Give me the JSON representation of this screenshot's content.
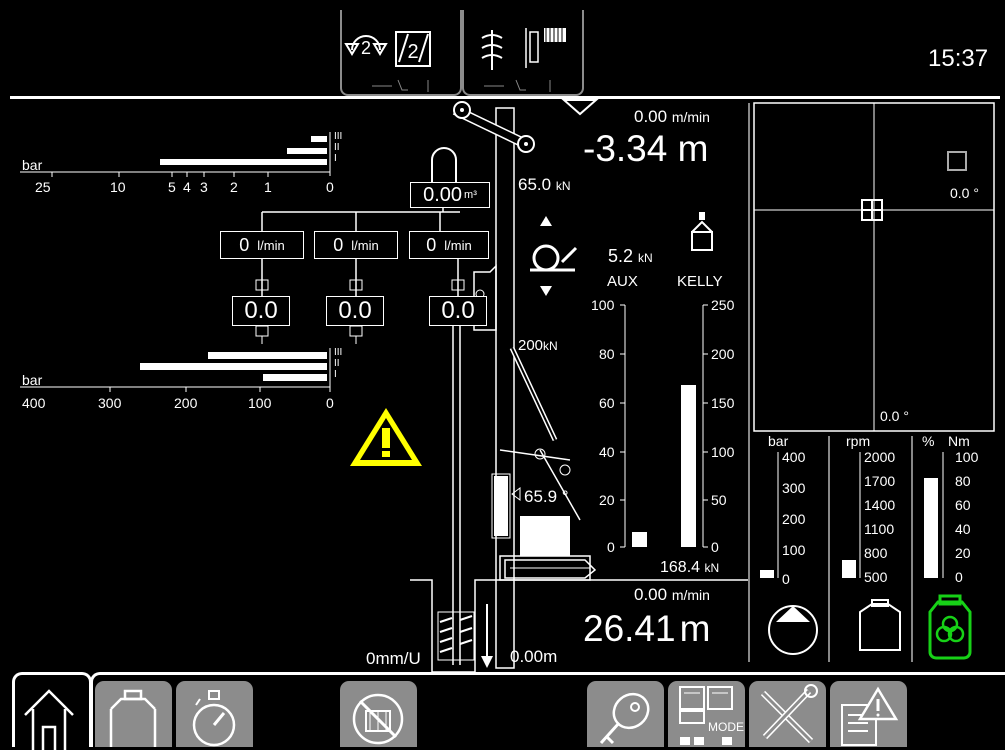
{
  "header": {
    "clock": "15:37",
    "mode_icons": [
      "rotation-2-icon",
      "winch-2-icon",
      "auger-icon",
      "winch-icon"
    ]
  },
  "pump_pressure": {
    "unit": "bar",
    "scale": [
      "25",
      "10",
      "5",
      "4",
      "3",
      "2",
      "1",
      "0"
    ],
    "level_labels": [
      "III",
      "II",
      "I"
    ]
  },
  "hydraulic": {
    "volume": "0.00",
    "volume_unit": "m³",
    "flow": [
      {
        "value": "0",
        "unit": "l/min"
      },
      {
        "value": "0",
        "unit": "l/min"
      },
      {
        "value": "0",
        "unit": "l/min"
      }
    ],
    "cylinder_values": [
      "0.0",
      "0.0",
      "0.0"
    ]
  },
  "load_pressure": {
    "unit": "bar",
    "scale": [
      "400",
      "300",
      "200",
      "100",
      "0"
    ],
    "level_labels": [
      "III",
      "II",
      "I"
    ]
  },
  "rig": {
    "crowd_force": "65.0",
    "crowd_force_unit": "kN",
    "aux_force": "5.2",
    "aux_force_unit": "kN",
    "crowd_limit": "200",
    "crowd_limit_unit": "kN",
    "mast_angle": "65.9 °",
    "aux_label": "AUX",
    "kelly_label": "KELLY",
    "rotation_ratio": "0mm/U",
    "tool_depth": "0.00m"
  },
  "kelly": {
    "speed_top": "0.00",
    "speed_top_unit": "m/min",
    "depth_top": "-3.34 m",
    "force_bottom": "168.4",
    "force_bottom_unit": "kN",
    "speed_bottom": "0.00",
    "speed_bottom_unit": "m/min",
    "depth_bottom": "26.41",
    "depth_bottom_unit": "m"
  },
  "winch_gauges": {
    "aux_scale": [
      "100",
      "80",
      "60",
      "40",
      "20",
      "0"
    ],
    "kelly_scale": [
      "250",
      "200",
      "150",
      "100",
      "50",
      "0"
    ],
    "aux_fraction": 0.06,
    "kelly_fraction": 0.67
  },
  "inclination": {
    "angle_x": "0.0 °",
    "angle_y": "0.0 °"
  },
  "engine": {
    "bar_label": "bar",
    "rpm_label": "rpm",
    "percent_label": "%",
    "nm_label": "Nm",
    "bar_scale": [
      "400",
      "300",
      "200",
      "100",
      "0"
    ],
    "rpm_scale": [
      "2000",
      "1700",
      "1400",
      "1100",
      "800",
      "500"
    ],
    "nm_scale": [
      "100",
      "80",
      "60",
      "40",
      "20",
      "0"
    ],
    "bar_fraction": 0.06,
    "rpm_fraction": 0.14,
    "load_fraction": 0.79,
    "status_color": "#17d117"
  },
  "toolbar": {
    "mode_label": "MODE",
    "items": [
      "home",
      "engine",
      "timer",
      "hammer-off",
      "key",
      "mode",
      "tools",
      "warning-list"
    ]
  },
  "colors": {
    "warning": "#ffff00",
    "button": "#8c8c8c",
    "active": "#17d117"
  }
}
